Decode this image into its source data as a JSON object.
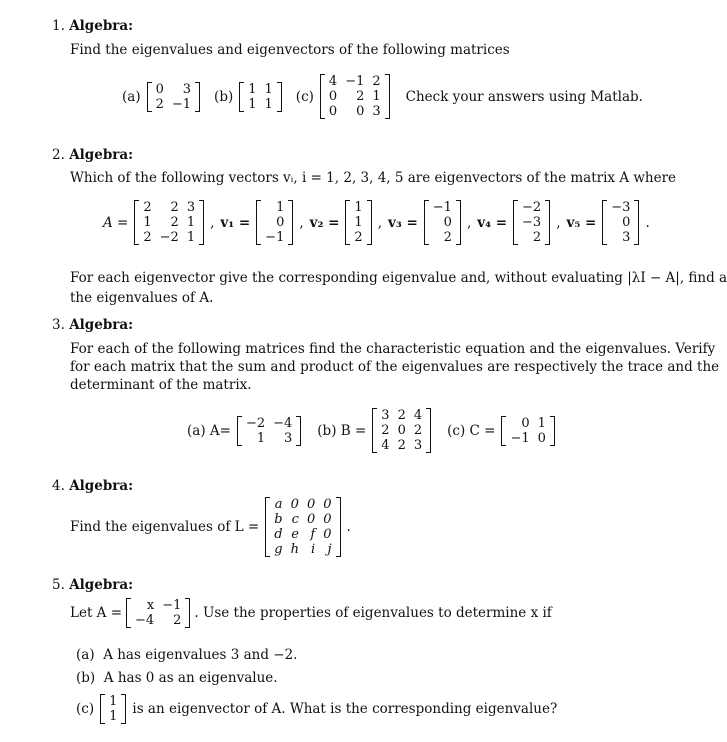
{
  "problems": [
    {
      "number": "1.",
      "title": "Algebra:",
      "text": "Find the eigenvalues and eigenvectors of the following matrices",
      "matrices": [
        {
          "label": "(a)",
          "rows": [
            [
              "0",
              "3"
            ],
            [
              "2",
              "−1"
            ]
          ]
        },
        {
          "label": "(b)",
          "rows": [
            [
              "1",
              "1"
            ],
            [
              "1",
              "1"
            ]
          ]
        },
        {
          "label": "(c)",
          "rows": [
            [
              "4",
              "−1",
              "2"
            ],
            [
              "0",
              "2",
              "1"
            ],
            [
              "0",
              "0",
              "3"
            ]
          ]
        }
      ],
      "note": "Check your answers using Matlab."
    },
    {
      "number": "2.",
      "title": "Algebra:",
      "text": "Which of the following vectors vᵢ, i = 1, 2, 3, 4, 5 are eigenvectors of the matrix A where",
      "matrix_label": "A =",
      "matrix": [
        [
          "2",
          "2",
          "3"
        ],
        [
          "1",
          "2",
          "1"
        ],
        [
          "2",
          "−2",
          "1"
        ]
      ],
      "vectors": [
        {
          "label": "v₁ =",
          "values": [
            "1",
            "0",
            "−1"
          ]
        },
        {
          "label": "v₂ =",
          "values": [
            "1",
            "1",
            "2"
          ]
        },
        {
          "label": "v₃ =",
          "values": [
            "−1",
            "0",
            "2"
          ]
        },
        {
          "label": "v₄ =",
          "values": [
            "−2",
            "−3",
            "2"
          ]
        },
        {
          "label": "v₅ =",
          "values": [
            "−3",
            "0",
            "3"
          ]
        }
      ],
      "followup_1": "For each eigenvector give the corresponding eigenvalue and, without evaluating |λI − A|, find all",
      "followup_2": "the eigenvalues of A."
    },
    {
      "number": "3.",
      "title": "Algebra:",
      "text_1": "For each of the following matrices find the characteristic equation and the eigenvalues. Verify",
      "text_2": "for each matrix that the sum and product of the eigenvalues are respectively the trace and the",
      "text_3": "determinant of the matrix.",
      "matrices": [
        {
          "label": "(a) A=",
          "rows": [
            [
              "−2",
              "−4"
            ],
            [
              "1",
              "3"
            ]
          ]
        },
        {
          "label": "(b) B =",
          "rows": [
            [
              "3",
              "2",
              "4"
            ],
            [
              "2",
              "0",
              "2"
            ],
            [
              "4",
              "2",
              "3"
            ]
          ]
        },
        {
          "label": "(c) C =",
          "rows": [
            [
              "0",
              "1"
            ],
            [
              "−1",
              "0"
            ]
          ]
        }
      ]
    },
    {
      "number": "4.",
      "title": "Algebra:",
      "text": "Find the eigenvalues of L =",
      "matrix": [
        [
          "a",
          "0",
          "0",
          "0"
        ],
        [
          "b",
          "c",
          "0",
          "0"
        ],
        [
          "d",
          "e",
          "f",
          "0"
        ],
        [
          "g",
          "h",
          "i",
          "j"
        ]
      ]
    },
    {
      "number": "5.",
      "title": "Algebra:",
      "text_pre": "Let A =",
      "matrix": [
        [
          "x",
          "−1"
        ],
        [
          "−4",
          "2"
        ]
      ],
      "text_post": ". Use the properties of eigenvalues to determine x if",
      "parts": [
        {
          "label": "(a)",
          "text": "A has eigenvalues 3 and −2."
        },
        {
          "label": "(b)",
          "text": "A has 0 as an eigenvalue."
        },
        {
          "label": "(c)",
          "vector": [
            "1",
            "1"
          ],
          "text": "is an eigenvector of A. What is the corresponding eigenvalue?"
        }
      ]
    }
  ]
}
